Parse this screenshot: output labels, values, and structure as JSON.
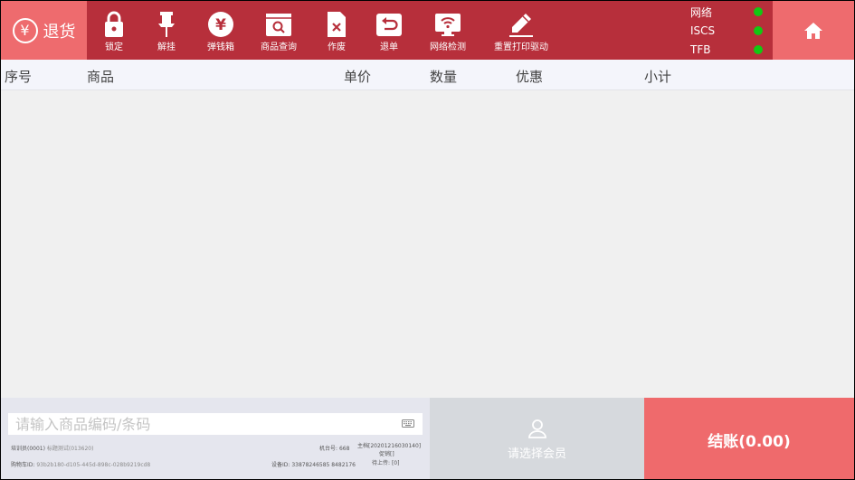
{
  "mode": {
    "icon": "yen-circle-icon",
    "label": "退货"
  },
  "toolbar": [
    {
      "id": "lock",
      "label": "锁定",
      "icon": "lock-icon"
    },
    {
      "id": "hang",
      "label": "解挂",
      "icon": "pin-icon"
    },
    {
      "id": "drawer",
      "label": "弹钱箱",
      "icon": "yen-icon"
    },
    {
      "id": "search",
      "label": "商品查询",
      "icon": "product-search-icon"
    },
    {
      "id": "void",
      "label": "作废",
      "icon": "void-document-icon"
    },
    {
      "id": "return",
      "label": "退单",
      "icon": "return-order-icon"
    },
    {
      "id": "network",
      "label": "网络检测",
      "icon": "wifi-monitor-icon"
    },
    {
      "id": "printer",
      "label": "重置打印驱动",
      "icon": "pencil-icon"
    }
  ],
  "status": [
    {
      "label": "网络",
      "color": "#12c812"
    },
    {
      "label": "ISCS",
      "color": "#12c812"
    },
    {
      "label": "TFB",
      "color": "#12c812"
    }
  ],
  "home_icon": "home-icon",
  "table": {
    "columns": [
      "序号",
      "商品",
      "单价",
      "数量",
      "优惠",
      "小计"
    ],
    "rows": []
  },
  "scan": {
    "placeholder": "请输入商品编码/条码",
    "icon": "keyboard-icon"
  },
  "info": {
    "trainer_label": "培训员(0001)",
    "trainer_value": "标题测试(013620)",
    "device_no_label": "机台号:",
    "device_no_value": "668",
    "version_label": "主档[20201216030140]",
    "version_sub": "促销[]",
    "cart_label": "购物车ID:",
    "cart_value": "93b2b180-d105-445d-898c-028b9219cd8",
    "device_id_label": "设备ID:",
    "device_id_value": "33878246585 8482176",
    "pending_label": "待上传:",
    "pending_value": "[0]"
  },
  "member": {
    "icon": "person-icon",
    "label": "请选择会员"
  },
  "checkout": {
    "label": "结账(0.00)"
  },
  "colors": {
    "topbar": "#b72f3b",
    "accent": "#ee6b6e",
    "status_ok": "#12c812",
    "list_bg": "#f0f0f0"
  }
}
